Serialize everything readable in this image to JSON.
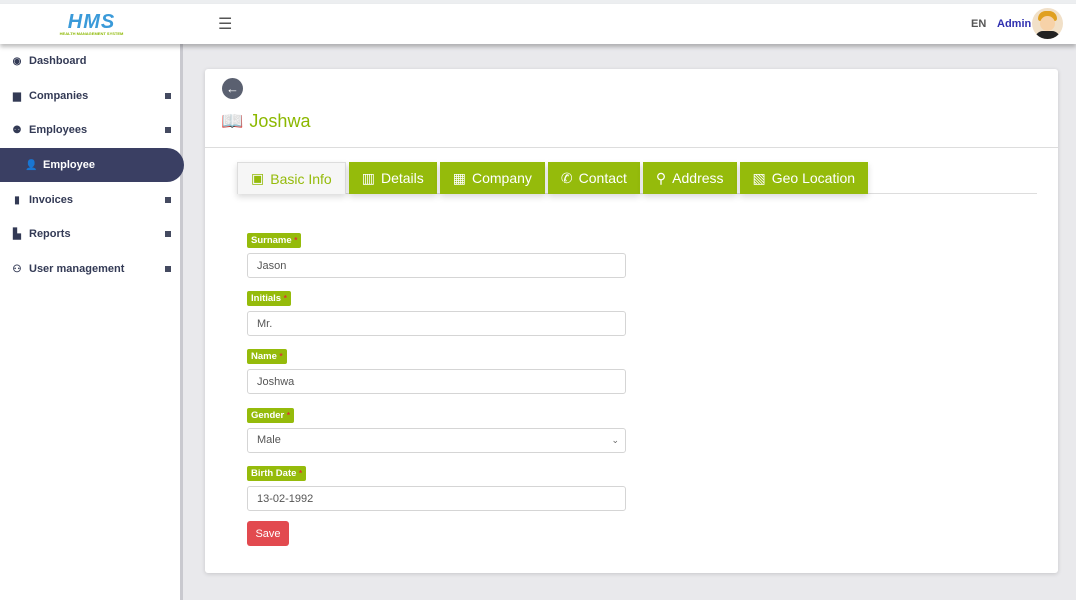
{
  "header": {
    "logo_text": "HMS",
    "logo_sub": "HEALTH MANAGEMENT SYSTEM",
    "menu_icon": "hamburger-icon",
    "lang": "EN",
    "user": "Admin"
  },
  "sidebar": {
    "items": [
      {
        "label": "Dashboard",
        "icon": "dashboard-icon"
      },
      {
        "label": "Companies",
        "icon": "building-icon"
      },
      {
        "label": "Employees",
        "icon": "users-icon"
      },
      {
        "label": "Employee",
        "icon": "user-check-icon",
        "active": true
      },
      {
        "label": "Invoices",
        "icon": "invoice-icon"
      },
      {
        "label": "Reports",
        "icon": "chart-icon"
      },
      {
        "label": "User management",
        "icon": "user-group-icon"
      }
    ]
  },
  "page": {
    "title": "Joshwa"
  },
  "tabs": [
    {
      "label": "Basic Info",
      "active": true
    },
    {
      "label": "Details"
    },
    {
      "label": "Company"
    },
    {
      "label": "Contact"
    },
    {
      "label": "Address"
    },
    {
      "label": "Geo Location"
    }
  ],
  "form": {
    "fields": [
      {
        "label": "Surname",
        "value": "Jason"
      },
      {
        "label": "Initials",
        "value": "Mr."
      },
      {
        "label": "Name",
        "value": "Joshwa"
      },
      {
        "label": "Gender",
        "value": "Male"
      },
      {
        "label": "Birth Date",
        "value": "13-02-1992"
      }
    ],
    "required_mark": "*",
    "save_label": "Save"
  },
  "colors": {
    "accent": "#95bb0b",
    "sidebar_active": "#3a3f63",
    "save": "#e24a4f"
  }
}
